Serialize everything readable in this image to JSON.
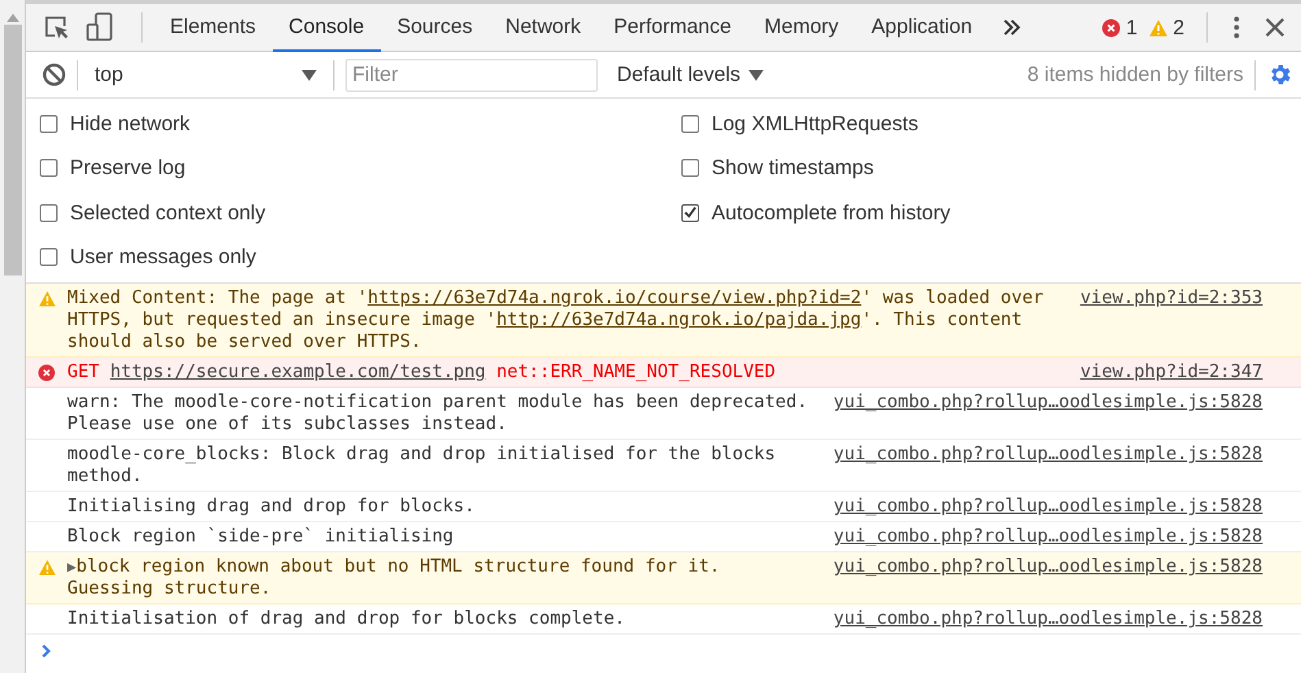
{
  "toolbar": {
    "tabs": [
      {
        "label": "Elements",
        "selected": false
      },
      {
        "label": "Console",
        "selected": true
      },
      {
        "label": "Sources",
        "selected": false
      },
      {
        "label": "Network",
        "selected": false
      },
      {
        "label": "Performance",
        "selected": false
      },
      {
        "label": "Memory",
        "selected": false
      },
      {
        "label": "Application",
        "selected": false
      }
    ],
    "error_count": "1",
    "warning_count": "2"
  },
  "console_toolbar": {
    "context": "top",
    "filter_placeholder": "Filter",
    "levels": "Default levels",
    "hidden_note": "8 items hidden by filters"
  },
  "settings": [
    {
      "label": "Hide network",
      "checked": false
    },
    {
      "label": "Log XMLHttpRequests",
      "checked": false
    },
    {
      "label": "Preserve log",
      "checked": false
    },
    {
      "label": "Show timestamps",
      "checked": false
    },
    {
      "label": "Selected context only",
      "checked": false
    },
    {
      "label": "Autocomplete from history",
      "checked": true
    },
    {
      "label": "User messages only",
      "checked": false
    }
  ],
  "messages": [
    {
      "kind": "warning",
      "source": "view.php?id=2:353",
      "parts": [
        {
          "kind": "text",
          "text": "Mixed Content: The page at '"
        },
        {
          "kind": "link",
          "text": "https://63e7d74a.ngrok.io/course/view.php?id=2"
        },
        {
          "kind": "text",
          "text": "' was loaded over HTTPS, but requested an insecure image '"
        },
        {
          "kind": "link",
          "text": "http://63e7d74a.ngrok.io/pajda.jpg"
        },
        {
          "kind": "text",
          "text": "'. This content should also be served over HTTPS."
        }
      ]
    },
    {
      "kind": "error",
      "source": "view.php?id=2:347",
      "parts": [
        {
          "kind": "text",
          "text": "GET"
        },
        {
          "kind": "link",
          "text": "https://secure.example.com/test.png"
        },
        {
          "kind": "text",
          "text": "net::ERR_NAME_NOT_RESOLVED"
        }
      ]
    },
    {
      "kind": "log",
      "source": "yui_combo.php?rollup…oodlesimple.js:5828",
      "parts": [
        {
          "kind": "text",
          "text": "warn: The moodle-core-notification parent module has been deprecated. Please use one of its subclasses instead."
        }
      ]
    },
    {
      "kind": "log",
      "source": "yui_combo.php?rollup…oodlesimple.js:5828",
      "parts": [
        {
          "kind": "text",
          "text": "moodle-core_blocks: Block drag and drop initialised for the blocks method."
        }
      ]
    },
    {
      "kind": "log",
      "source": "yui_combo.php?rollup…oodlesimple.js:5828",
      "parts": [
        {
          "kind": "text",
          "text": "Initialising drag and drop for blocks."
        }
      ]
    },
    {
      "kind": "log",
      "source": "yui_combo.php?rollup…oodlesimple.js:5828",
      "parts": [
        {
          "kind": "text",
          "text": "Block region `side-pre` initialising"
        }
      ]
    },
    {
      "kind": "warning",
      "expander": "▶",
      "source": "yui_combo.php?rollup…oodlesimple.js:5828",
      "parts": [
        {
          "kind": "text",
          "text": "block region known about but no HTML structure found for it. Guessing structure."
        }
      ]
    },
    {
      "kind": "log",
      "source": "yui_combo.php?rollup…oodlesimple.js:5828",
      "parts": [
        {
          "kind": "text",
          "text": "Initialisation of drag and drop for blocks complete."
        }
      ]
    }
  ]
}
